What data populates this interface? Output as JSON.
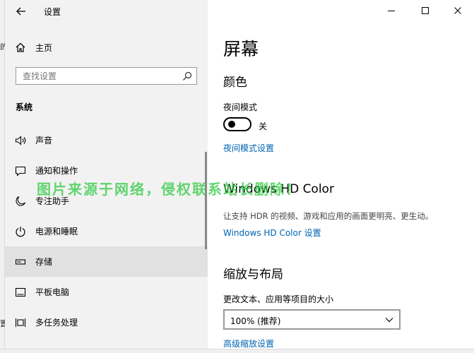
{
  "window": {
    "title": "设置",
    "controls": {
      "minimize_icon": "minimize-icon",
      "maximize_icon": "maximize-icon",
      "close_icon": "close-icon"
    }
  },
  "left_edge": {
    "fragment_1": "的",
    "fragment_2": "置"
  },
  "sidebar": {
    "home_label": "主页",
    "search_placeholder": "查找设置",
    "section_label": "系统",
    "items": [
      {
        "label": "声音",
        "icon": "speaker-icon",
        "selected": false
      },
      {
        "label": "通知和操作",
        "icon": "notification-icon",
        "selected": false
      },
      {
        "label": "专注助手",
        "icon": "moon-icon",
        "selected": false
      },
      {
        "label": "电源和睡眠",
        "icon": "power-icon",
        "selected": false
      },
      {
        "label": "存储",
        "icon": "storage-icon",
        "selected": true
      },
      {
        "label": "平板电脑",
        "icon": "tablet-icon",
        "selected": false
      },
      {
        "label": "多任务处理",
        "icon": "multitask-icon",
        "selected": false
      }
    ]
  },
  "main": {
    "page_title": "屏幕",
    "color_section": {
      "title": "颜色",
      "night_mode_label": "夜间模式",
      "toggle_state": "关",
      "night_mode_settings_link": "夜间模式设置"
    },
    "hdr_section": {
      "title": "Windows HD Color",
      "description": "让支持 HDR 的视频、游戏和应用的画面更明亮、更生动。",
      "settings_link": "Windows HD Color 设置"
    },
    "scale_section": {
      "title": "缩放与布局",
      "size_label": "更改文本、应用等项目的大小",
      "scale_value": "100% (推荐)",
      "advanced_link": "高级缩放设置"
    }
  },
  "watermark": "图片来源于网络，侵权联系站长删除！",
  "colors": {
    "accent_link": "#0063b1",
    "sidebar_bg": "#f2f2f2",
    "selected_bg": "#e1e1e1",
    "watermark": "#28c83c"
  }
}
